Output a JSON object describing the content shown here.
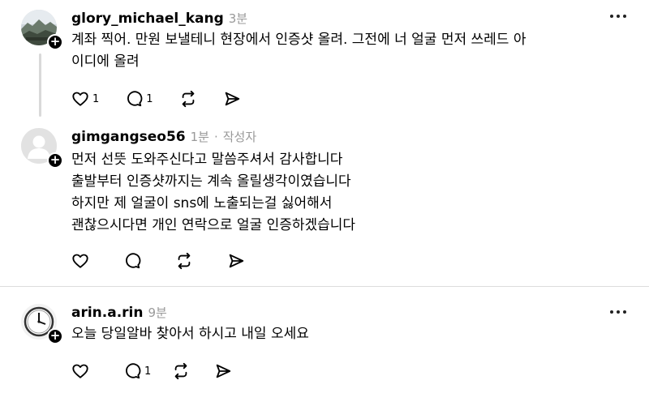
{
  "posts": [
    {
      "username": "glory_michael_kang",
      "time": "3분",
      "lines": [
        "계좌 찍어. 만원 보낼테니 현장에서 인증샷 올려. 그전에 너 얼굴 먼저 쓰레드 아",
        "이디에 올려"
      ],
      "like_count": "1",
      "reply_count": "1",
      "avatar_icon": "landscape-photo"
    },
    {
      "username": "gimgangseo56",
      "time": "1분",
      "separator": "·",
      "author_tag": "작성자",
      "lines": [
        "먼저 선뜻 도와주신다고 말씀주셔서 감사합니다",
        "출발부터 인증샷까지는 계속 올릴생각이였습니다",
        "하지만 제 얼굴이 sns에 노출되는걸 싫어해서",
        "괜찮으시다면 개인 연락으로 얼굴 인증하겠습니다"
      ],
      "avatar_icon": "default-person"
    },
    {
      "username": "arin.a.rin",
      "time": "9분",
      "lines": [
        "오늘 당일알바 찾아서 하시고 내일 오세요"
      ],
      "reply_count": "1",
      "avatar_icon": "clock"
    }
  ],
  "icons": {
    "like": "heart-icon",
    "reply": "speech-bubble-icon",
    "repost": "repost-icon",
    "share": "send-icon",
    "more": "more-dots-icon",
    "follow": "plus-icon"
  }
}
